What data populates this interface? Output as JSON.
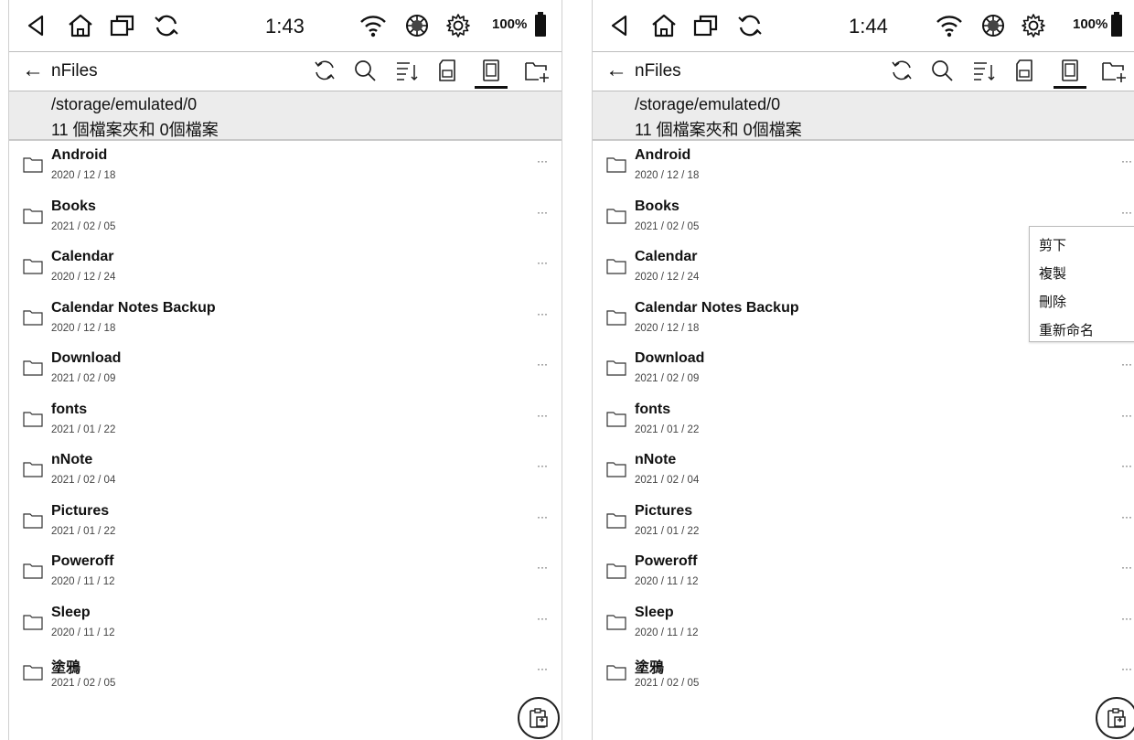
{
  "left": {
    "status": {
      "time": "1:43",
      "battery": "100%"
    },
    "toolbar": {
      "title": "nFiles"
    },
    "header": {
      "path": "/storage/emulated/0",
      "count": "11 個檔案夾和 0個檔案"
    },
    "files": [
      {
        "name": "Android",
        "date": "2020 / 12 / 18"
      },
      {
        "name": "Books",
        "date": "2021 / 02 / 05"
      },
      {
        "name": "Calendar",
        "date": "2020 / 12 / 24"
      },
      {
        "name": "Calendar Notes Backup",
        "date": "2020 / 12 / 18"
      },
      {
        "name": "Download",
        "date": "2021 / 02 / 09"
      },
      {
        "name": "fonts",
        "date": "2021 / 01 / 22"
      },
      {
        "name": "nNote",
        "date": "2021 / 02 / 04"
      },
      {
        "name": "Pictures",
        "date": "2021 / 01 / 22"
      },
      {
        "name": "Poweroff",
        "date": "2020 / 11 / 12"
      },
      {
        "name": "Sleep",
        "date": "2020 / 11 / 12"
      },
      {
        "name": "塗鴉",
        "date": "2021 / 02 / 05"
      }
    ]
  },
  "right": {
    "status": {
      "time": "1:44",
      "battery": "100%"
    },
    "toolbar": {
      "title": "nFiles"
    },
    "header": {
      "path": "/storage/emulated/0",
      "count": "11 個檔案夾和 0個檔案"
    },
    "files": [
      {
        "name": "Android",
        "date": "2020 / 12 / 18"
      },
      {
        "name": "Books",
        "date": "2021 / 02 / 05"
      },
      {
        "name": "Calendar",
        "date": "2020 / 12 / 24"
      },
      {
        "name": "Calendar Notes Backup",
        "date": "2020 / 12 / 18"
      },
      {
        "name": "Download",
        "date": "2021 / 02 / 09"
      },
      {
        "name": "fonts",
        "date": "2021 / 01 / 22"
      },
      {
        "name": "nNote",
        "date": "2021 / 02 / 04"
      },
      {
        "name": "Pictures",
        "date": "2021 / 01 / 22"
      },
      {
        "name": "Poweroff",
        "date": "2020 / 11 / 12"
      },
      {
        "name": "Sleep",
        "date": "2020 / 11 / 12"
      },
      {
        "name": "塗鴉",
        "date": "2021 / 02 / 05"
      }
    ],
    "context_menu": {
      "cut": "剪下",
      "copy": "複製",
      "delete": "刪除",
      "rename": "重新命名"
    }
  },
  "more_label": "···",
  "icons": [
    "back-triangle-icon",
    "home-icon",
    "recent-apps-icon",
    "refresh-icon",
    "wifi-icon",
    "aperture-icon",
    "gear-icon",
    "battery-icon",
    "back-arrow-icon",
    "search-icon",
    "sort-icon",
    "sd-card-icon",
    "internal-storage-icon",
    "new-folder-icon",
    "folder-icon",
    "paste-icon"
  ]
}
